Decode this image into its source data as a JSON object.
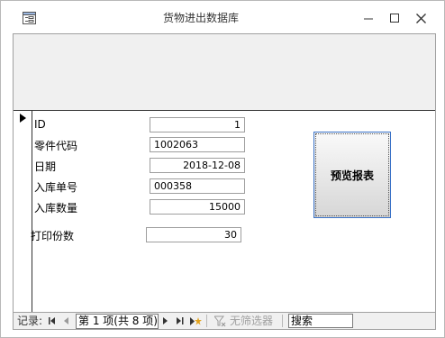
{
  "window": {
    "title": "货物进出数据库",
    "icons": {
      "app": "form-view-icon",
      "minimize": "minimize-icon",
      "maximize": "maximize-icon",
      "close": "close-icon"
    }
  },
  "form": {
    "fields": [
      {
        "label": "ID",
        "value": "1"
      },
      {
        "label": "零件代码",
        "value": "1002063"
      },
      {
        "label": "日期",
        "value": "2018-12-08"
      },
      {
        "label": "入库单号",
        "value": "000358"
      },
      {
        "label": "入库数量",
        "value": "15000"
      }
    ],
    "print_count": {
      "label": "打印份数",
      "value": "30"
    },
    "preview_button": "预览报表"
  },
  "navigation": {
    "record_label": "记录:",
    "record_status": "第 1 项(共 8 项)",
    "filter_label": "无筛选器",
    "search_placeholder": "搜索",
    "icons": [
      "first-record-icon",
      "previous-record-icon",
      "next-record-icon",
      "last-record-icon",
      "new-record-icon",
      "filter-icon"
    ]
  }
}
